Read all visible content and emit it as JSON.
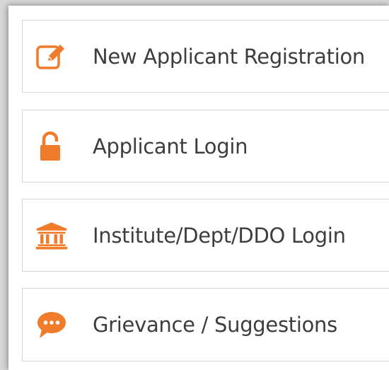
{
  "accent_color": "#f07b2b",
  "menu": {
    "items": [
      {
        "label": "New Applicant Registration",
        "icon": "edit-icon"
      },
      {
        "label": "Applicant Login",
        "icon": "unlock-icon"
      },
      {
        "label": "Institute/Dept/DDO Login",
        "icon": "institution-icon"
      },
      {
        "label": "Grievance / Suggestions",
        "icon": "chat-bubble-icon"
      }
    ]
  }
}
